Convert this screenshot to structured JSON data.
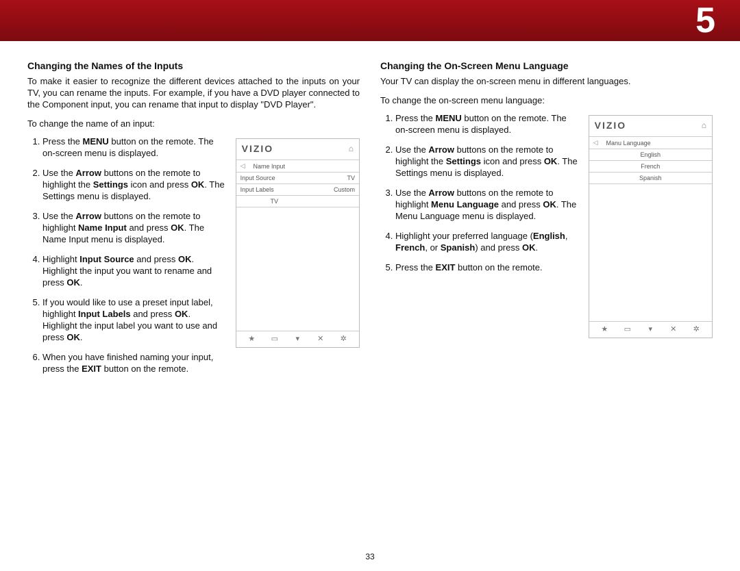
{
  "banner": {
    "chapter_number": "5"
  },
  "page_number": "33",
  "left": {
    "heading": "Changing the Names of the Inputs",
    "lead": "To make it easier to recognize the different devices attached to the inputs on your TV, you can rename the inputs. For example, if you have a DVD player connected to the Component input, you can rename that input to display \"DVD Player\".",
    "intro": "To change the name of an input:",
    "steps": [
      "Press the <b>MENU</b> button on the remote. The on-screen menu is displayed.",
      "Use the <b>Arrow</b> buttons on the remote to highlight the <b>Settings</b> icon and press <b>OK</b>. The Settings menu is displayed.",
      "Use the <b>Arrow</b> buttons on the remote to highlight <b>Name Input</b> and press <b>OK</b>. The Name Input menu is displayed.",
      "Highlight <b>Input Source</b> and press <b>OK</b>. Highlight the input you want to rename and press <b>OK</b>.",
      "If you would like to use a preset input label, highlight <b>Input Labels</b> and press <b>OK</b>. Highlight the input label you want to use and press <b>OK</b>.",
      "When you have finished naming your input, press the <b>EXIT</b> button on the remote."
    ],
    "osd": {
      "brand": "VIZIO",
      "title": "Name Input",
      "rows": [
        {
          "l": "Input Source",
          "r": "TV"
        },
        {
          "l": "Input Labels",
          "r": "Custom"
        },
        {
          "l": "TV",
          "r": ""
        }
      ],
      "footer_icons": [
        "★",
        "▭",
        "▾",
        "✕",
        "✲"
      ]
    }
  },
  "right": {
    "heading": "Changing the On-Screen Menu Language",
    "lead": "Your TV can display the on-screen menu in different languages.",
    "intro": "To change the on-screen menu language:",
    "steps": [
      "Press the <b>MENU</b> button on the remote. The on-screen menu is displayed.",
      "Use the <b>Arrow</b> buttons on the remote to highlight the <b>Settings</b> icon and press <b>OK</b>. The Settings menu is displayed.",
      "Use the <b>Arrow</b> buttons on the remote to highlight <b>Menu Language</b> and press <b>OK</b>. The Menu Language menu is displayed.",
      "Highlight your preferred language (<b>English</b>, <b>French</b>, or <b>Spanish</b>) and press <b>OK</b>.",
      "Press the <b>EXIT</b> button on the remote."
    ],
    "osd": {
      "brand": "VIZIO",
      "title": "Manu Language",
      "rows": [
        {
          "c": "English"
        },
        {
          "c": "French"
        },
        {
          "c": "Spanish"
        }
      ],
      "footer_icons": [
        "★",
        "▭",
        "▾",
        "✕",
        "✲"
      ]
    }
  }
}
